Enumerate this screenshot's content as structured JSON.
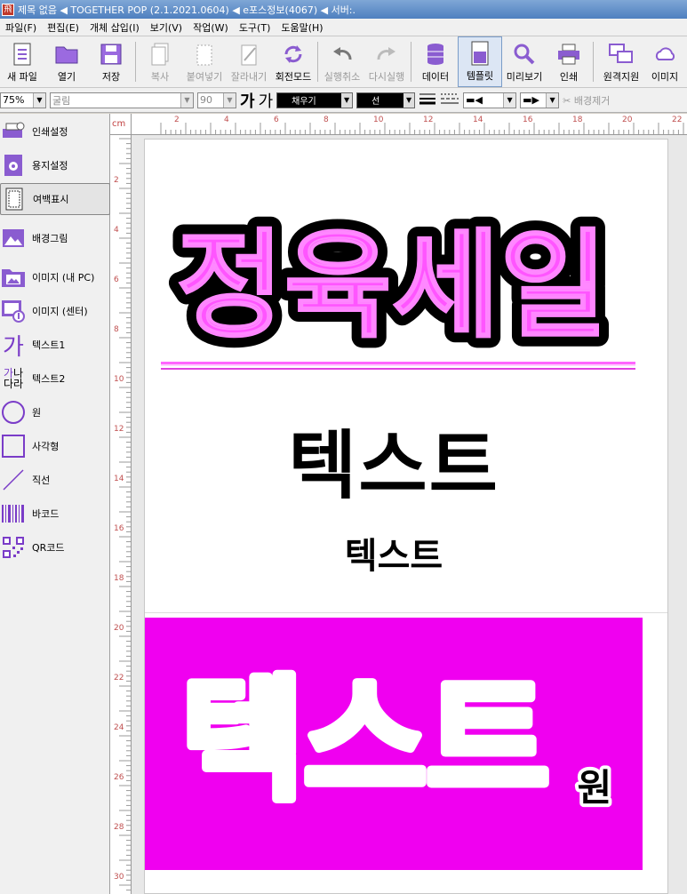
{
  "window": {
    "title": "제목 없음 ◀ TOGETHER POP (2.1.2021.0604) ◀ e포스정보(4067) ◀ 서버:."
  },
  "menu": [
    "파일(F)",
    "편집(E)",
    "개체 삽입(I)",
    "보기(V)",
    "작업(W)",
    "도구(T)",
    "도움말(H)"
  ],
  "toolbar": {
    "new": "새 파일",
    "open": "열기",
    "save": "저장",
    "copy": "복사",
    "paste": "붙여넣기",
    "cut": "잘라내기",
    "rotate": "회전모드",
    "undo": "실행취소",
    "redo": "다시실행",
    "data": "데이터",
    "template": "템플릿",
    "preview": "미리보기",
    "print": "인쇄",
    "remote": "원격지원",
    "image": "이미지"
  },
  "format": {
    "zoom": "75%",
    "font": "굴림",
    "size": "90",
    "bold_ga": "가",
    "ga": "가",
    "fill": "채우기",
    "line": "선",
    "bg_remove": "배경제거"
  },
  "sidebar": {
    "items": [
      "인쇄설정",
      "용지설정",
      "여백표시",
      "배경그림",
      "이미지 (내 PC)",
      "이미지 (센터)",
      "텍스트1",
      "텍스트2",
      "원",
      "사각형",
      "직선",
      "바코드",
      "QR코드"
    ],
    "glyph_text1": "가",
    "glyph_text2_a": "가",
    "glyph_text2_b": "나",
    "glyph_text2_c": "다라"
  },
  "ruler": {
    "unit": "cm",
    "h_ticks": [
      "2",
      "4",
      "6",
      "8",
      "10",
      "12",
      "14",
      "16",
      "18",
      "20",
      "22"
    ],
    "v_ticks": [
      "2",
      "4",
      "6",
      "8",
      "10",
      "12",
      "14",
      "16",
      "18",
      "20",
      "22",
      "24",
      "26",
      "28",
      "30"
    ]
  },
  "document": {
    "headline": "정육세일",
    "text_large": "텍스트",
    "text_small": "텍스트",
    "box_text": "텍스트",
    "won": "원"
  },
  "colors": {
    "pink": "#f000f0",
    "headline_fill": "#ff55ff",
    "sidebar_icon": "#7a3cc8"
  }
}
